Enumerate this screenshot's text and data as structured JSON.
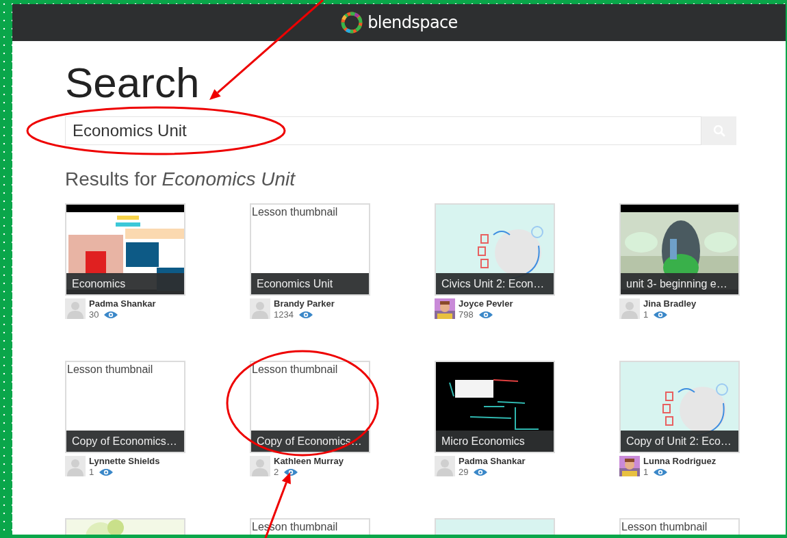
{
  "header": {
    "logo_text": "blendspace"
  },
  "page_title": "Search",
  "search": {
    "value": "Economics Unit"
  },
  "results_heading": "Results for *Economics Unit*",
  "cards": [
    {
      "thumbnail": {
        "kind": "picture"
      },
      "title": "Economics",
      "author": "Padma Shankar",
      "views": "30",
      "avatar": {
        "kind": "silhouette"
      }
    },
    {
      "thumbnail": {
        "kind": "placeholder",
        "text": "Lesson thumbnail"
      },
      "title": "Economics Unit",
      "author": "Brandy Parker",
      "views": "1234",
      "avatar": {
        "kind": "silhouette"
      }
    },
    {
      "thumbnail": {
        "kind": "picture"
      },
      "title": "Civics Unit 2: Econ…",
      "author": "Joyce Pevler",
      "views": "798",
      "avatar": {
        "kind": "picture"
      }
    },
    {
      "thumbnail": {
        "kind": "picture"
      },
      "title": "unit 3- beginning e…",
      "author": "Jina Bradley",
      "views": "1",
      "avatar": {
        "kind": "silhouette"
      }
    },
    {
      "thumbnail": {
        "kind": "placeholder",
        "text": "Lesson thumbnail"
      },
      "title": "Copy of Economics…",
      "author": "Lynnette Shields",
      "views": "1",
      "avatar": {
        "kind": "silhouette"
      }
    },
    {
      "thumbnail": {
        "kind": "placeholder",
        "text": "Lesson thumbnail"
      },
      "title": "Copy of Economics…",
      "author": "Kathleen Murray",
      "views": "2",
      "avatar": {
        "kind": "silhouette"
      }
    },
    {
      "thumbnail": {
        "kind": "picture"
      },
      "title": "Micro Economics",
      "author": "Padma Shankar",
      "views": "29",
      "avatar": {
        "kind": "silhouette"
      }
    },
    {
      "thumbnail": {
        "kind": "picture"
      },
      "title": "Copy of Unit 2: Eco…",
      "author": "Lunna Rodriguez",
      "views": "1",
      "avatar": {
        "kind": "picture"
      }
    },
    {
      "thumbnail": {
        "kind": "picture"
      }
    },
    {
      "thumbnail": {
        "kind": "placeholder",
        "text": "Lesson thumbnail"
      }
    },
    {
      "thumbnail": {
        "kind": "picture"
      }
    },
    {
      "thumbnail": {
        "kind": "placeholder",
        "text": "Lesson thumbnail"
      }
    }
  ],
  "annotations": [
    {
      "kind": "arrow"
    },
    {
      "kind": "ellipse"
    },
    {
      "kind": "ellipse"
    },
    {
      "kind": "arrow"
    }
  ]
}
